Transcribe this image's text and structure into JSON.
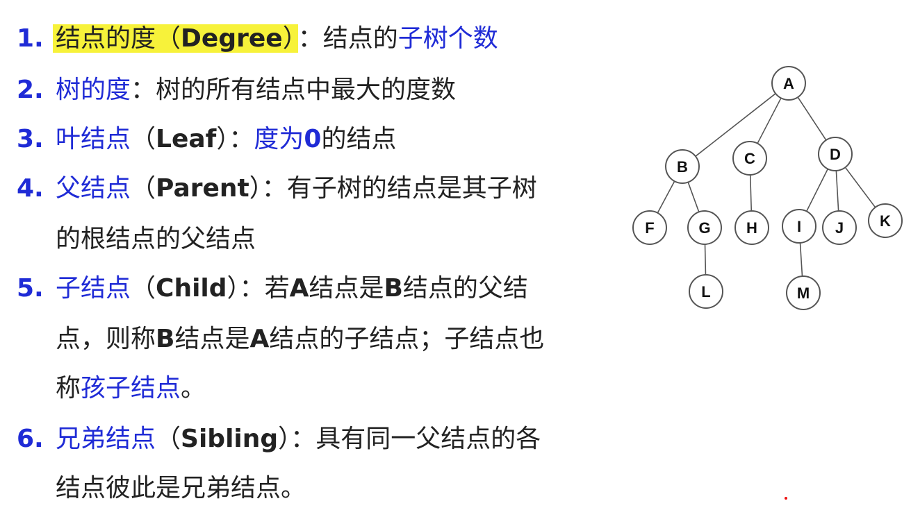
{
  "items": [
    {
      "num": "1.",
      "term": "结点的度",
      "paren_open": "（",
      "en": "Degree",
      "paren_close": "）",
      "colon": "：",
      "def_plain": "结点的",
      "def_blue": "子树个数"
    },
    {
      "num": "2.",
      "term": "树的度",
      "colon": "：",
      "def": "树的所有结点中最大的度数"
    },
    {
      "num": "3.",
      "term": "叶结点",
      "paren_open": "（",
      "en": "Leaf",
      "paren_close": "）",
      "colon": "：",
      "def_blue_a": "度为",
      "def_blue_zero": "0",
      "def_tail": "的结点"
    },
    {
      "num": "4.",
      "term": "父结点",
      "paren_open": "（",
      "en": "Parent",
      "paren_close": "）",
      "colon": "：",
      "def1": "有子树的结点是其子树",
      "def2": "的根结点的父结点"
    },
    {
      "num": "5.",
      "term": "子结点",
      "paren_open": "（",
      "en": "Child",
      "paren_close": "）",
      "colon": "：",
      "l1_a": "若",
      "l1_A": "A",
      "l1_b": "结点是",
      "l1_B": "B",
      "l1_c": "结点的父结",
      "l2_a": "点，则称",
      "l2_B": "B",
      "l2_b": "结点是",
      "l2_A": "A",
      "l2_c": "结点的子结点；子结点也",
      "l3_a": "称",
      "l3_blue": "孩子结点",
      "l3_b": "。"
    },
    {
      "num": "6.",
      "term": "兄弟结点",
      "paren_open": "（",
      "en": "Sibling",
      "paren_close": "）",
      "colon": "：",
      "def1": "具有同一父结点的各",
      "def2": "结点彼此是兄弟结点。"
    }
  ],
  "tree": {
    "nodes": [
      {
        "id": "A",
        "label": "A"
      },
      {
        "id": "B",
        "label": "B"
      },
      {
        "id": "C",
        "label": "C"
      },
      {
        "id": "D",
        "label": "D"
      },
      {
        "id": "F",
        "label": "F"
      },
      {
        "id": "G",
        "label": "G"
      },
      {
        "id": "H",
        "label": "H"
      },
      {
        "id": "I",
        "label": "I"
      },
      {
        "id": "J",
        "label": "J"
      },
      {
        "id": "K",
        "label": "K"
      },
      {
        "id": "L",
        "label": "L"
      },
      {
        "id": "M",
        "label": "M"
      }
    ],
    "edges": [
      [
        "A",
        "B"
      ],
      [
        "A",
        "C"
      ],
      [
        "A",
        "D"
      ],
      [
        "B",
        "F"
      ],
      [
        "B",
        "G"
      ],
      [
        "C",
        "H"
      ],
      [
        "D",
        "I"
      ],
      [
        "D",
        "J"
      ],
      [
        "D",
        "K"
      ],
      [
        "G",
        "L"
      ],
      [
        "I",
        "M"
      ]
    ]
  },
  "colors": {
    "accent_blue": "#1f2bd6",
    "highlight": "#f7f23a",
    "text": "#222222"
  }
}
